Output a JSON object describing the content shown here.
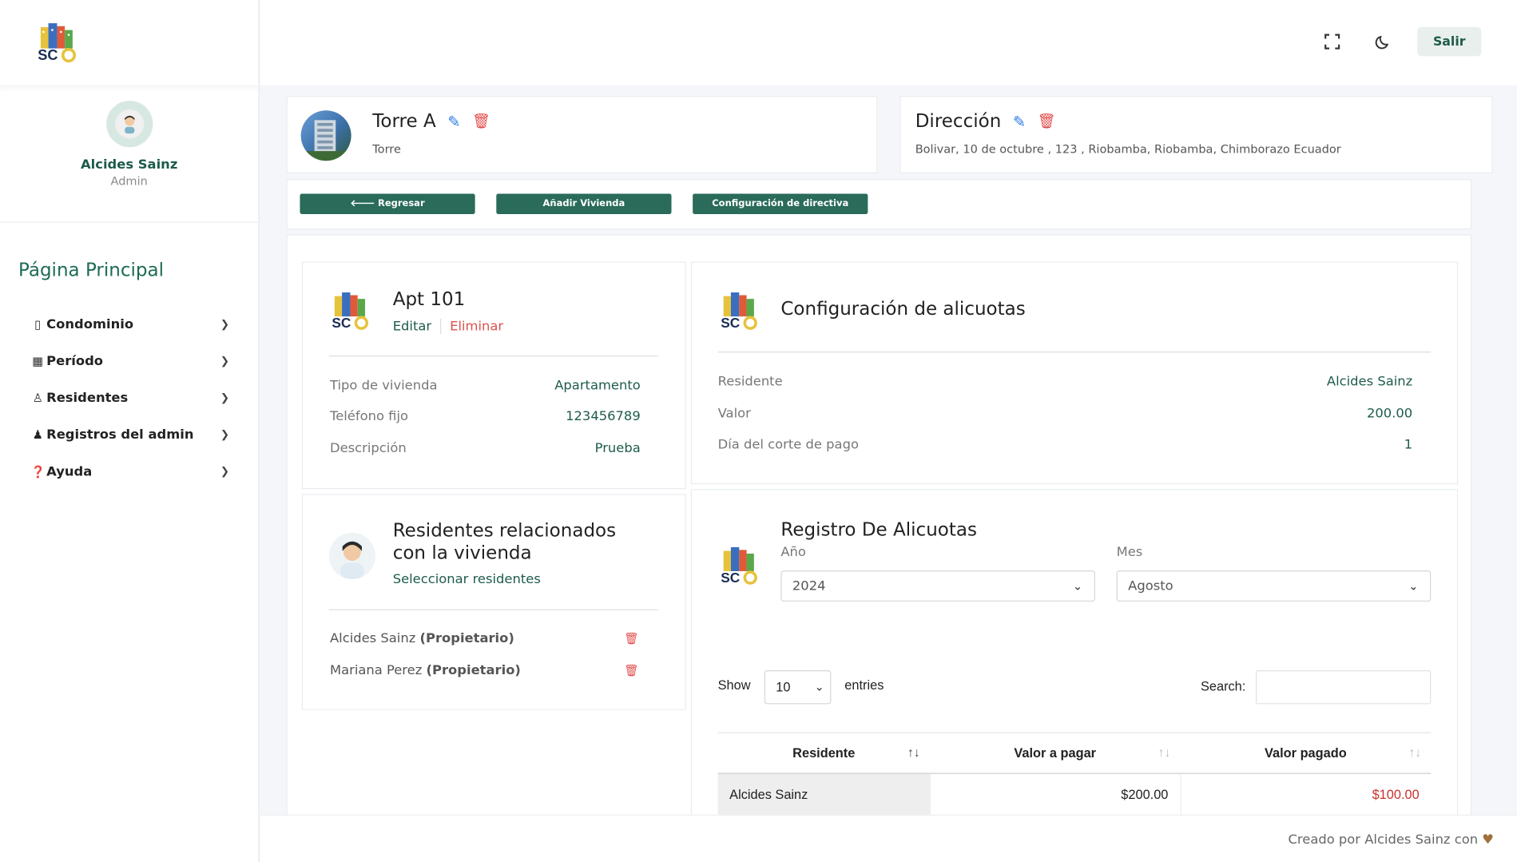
{
  "sidebar": {
    "user_name": "Alcides Sainz",
    "user_role": "Admin",
    "menu_title": "Página Principal",
    "items": [
      {
        "label": "Condominio",
        "icon": "building-icon"
      },
      {
        "label": "Período",
        "icon": "calendar-icon"
      },
      {
        "label": "Residentes",
        "icon": "person-icon"
      },
      {
        "label": "Registros del admin",
        "icon": "user-tie-icon"
      },
      {
        "label": "Ayuda",
        "icon": "question-circle-icon"
      }
    ]
  },
  "topbar": {
    "logout_label": "Salir"
  },
  "tower": {
    "title": "Torre A",
    "subtitle": "Torre"
  },
  "address": {
    "title": "Dirección",
    "text": "Bolivar, 10 de octubre , 123 , Riobamba, Riobamba, Chimborazo Ecuador"
  },
  "actions": {
    "back_label": "Regresar",
    "add_label": "Añadir Vivienda",
    "config_label": "Configuración de directiva"
  },
  "apartment": {
    "title": "Apt 101",
    "edit_label": "Editar",
    "delete_label": "Eliminar",
    "fields": [
      {
        "label": "Tipo de vivienda",
        "value": "Apartamento"
      },
      {
        "label": "Teléfono fijo",
        "value": "123456789"
      },
      {
        "label": "Descripción",
        "value": "Prueba"
      }
    ]
  },
  "aliquot_config": {
    "title": "Configuración de alicuotas",
    "fields": [
      {
        "label": "Residente",
        "value": "Alcides Sainz"
      },
      {
        "label": "Valor",
        "value": "200.00"
      },
      {
        "label": "Día del corte de pago",
        "value": "1"
      }
    ]
  },
  "residents": {
    "title_line1": "Residentes relacionados",
    "title_line2": "con la vivienda",
    "select_label": "Seleccionar residentes",
    "list": [
      {
        "name": "Alcides Sainz",
        "role": "(Propietario)"
      },
      {
        "name": "Mariana Perez",
        "role": "(Propietario)"
      }
    ]
  },
  "aliquot_log": {
    "title": "Registro De Alicuotas",
    "year_label": "Año",
    "year_value": "2024",
    "month_label": "Mes",
    "month_value": "Agosto",
    "show_label": "Show",
    "entries_value": "10",
    "entries_label": "entries",
    "search_label": "Search:",
    "search_value": "",
    "columns": [
      "Residente",
      "Valor a pagar",
      "Valor pagado"
    ],
    "rows": [
      {
        "resident": "Alcides Sainz",
        "to_pay": "$200.00",
        "paid": "$100.00"
      }
    ]
  },
  "footer": {
    "text": "Creado por Alcides Sainz con"
  },
  "colors": {
    "primary": "#2a6b5a",
    "accent_text": "#1e5b4c",
    "danger": "#e34a4a",
    "link_blue": "#2d7be5"
  }
}
